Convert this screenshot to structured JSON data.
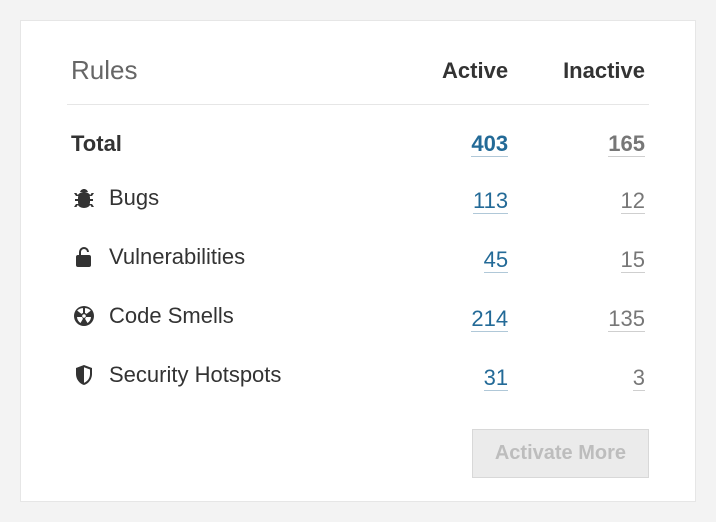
{
  "header": {
    "title": "Rules",
    "active_col": "Active",
    "inactive_col": "Inactive"
  },
  "rows": {
    "total": {
      "label": "Total",
      "active": "403",
      "inactive": "165"
    },
    "bugs": {
      "label": "Bugs",
      "active": "113",
      "inactive": "12"
    },
    "vulns": {
      "label": "Vulnerabilities",
      "active": "45",
      "inactive": "15"
    },
    "smells": {
      "label": "Code Smells",
      "active": "214",
      "inactive": "135"
    },
    "hotspots": {
      "label": "Security Hotspots",
      "active": "31",
      "inactive": "3"
    }
  },
  "footer": {
    "activate_more": "Activate More"
  }
}
